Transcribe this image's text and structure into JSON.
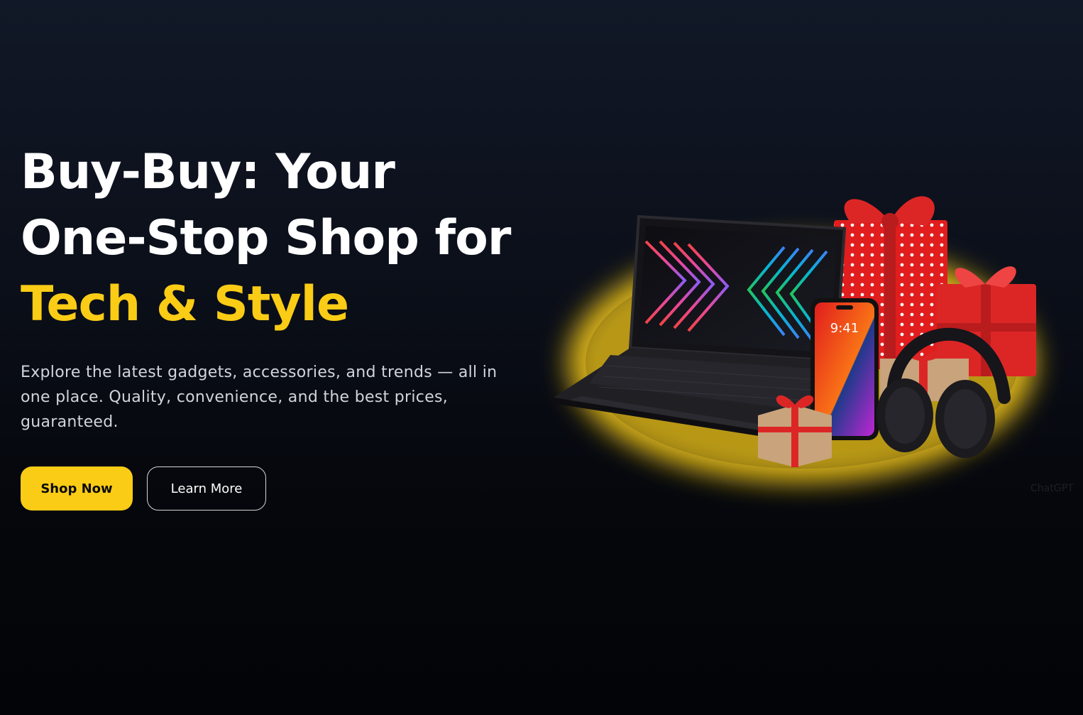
{
  "hero": {
    "headline_line1": "Buy-Buy: Your",
    "headline_line2": "One-Stop Shop for",
    "headline_accent": "Tech & Style",
    "subtitle": "Explore the latest gadgets, accessories, and trends — all in one place. Quality, convenience, and the best prices, guaranteed.",
    "primary_cta": "Shop Now",
    "secondary_cta": "Learn More"
  },
  "illustration": {
    "phone_time": "9:41",
    "watermark": "ChatGPT",
    "icons": [
      "laptop-icon",
      "gift-box-icon",
      "smartphone-icon",
      "headphones-icon"
    ]
  },
  "colors": {
    "accent": "#facc15",
    "background_top": "#111827",
    "background_bottom": "#030407",
    "text_primary": "#ffffff",
    "text_secondary": "#d1d5db",
    "gift_red": "#e11d1d"
  }
}
